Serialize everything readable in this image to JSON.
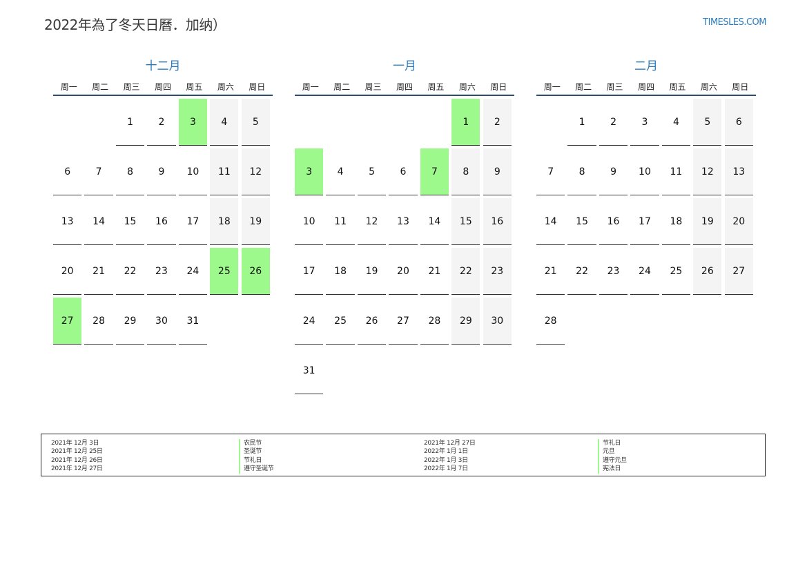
{
  "header": {
    "title": "2022年為了冬天日曆．加纳）",
    "site": "TIMESLES.COM"
  },
  "weekdays": [
    "周一",
    "周二",
    "周三",
    "周四",
    "周五",
    "周六",
    "周日"
  ],
  "months": [
    {
      "name": "十二月",
      "offset": 2,
      "days": 31,
      "holidays": [
        3,
        25,
        26,
        27
      ]
    },
    {
      "name": "一月",
      "offset": 5,
      "days": 31,
      "holidays": [
        1,
        3,
        7
      ]
    },
    {
      "name": "二月",
      "offset": 1,
      "days": 28,
      "holidays": []
    }
  ],
  "legend": {
    "col1_dates": [
      "2021年 12月 3日",
      "2021年 12月 25日",
      "2021年 12月 26日",
      "2021年 12月 27日"
    ],
    "col1_names": [
      "农民节",
      "圣诞节",
      "节礼日",
      "遵守圣诞节"
    ],
    "col2_dates": [
      "2021年 12月 27日",
      "2022年 1月 1日",
      "2022年 1月 3日",
      "2022年 1月 7日"
    ],
    "col2_names": [
      "节礼日",
      "元旦",
      "遵守元旦",
      "宪法日"
    ]
  },
  "colors": {
    "holiday": "#9df98b",
    "weekend": "#f4f4f4",
    "accent": "#2b7bbf"
  }
}
